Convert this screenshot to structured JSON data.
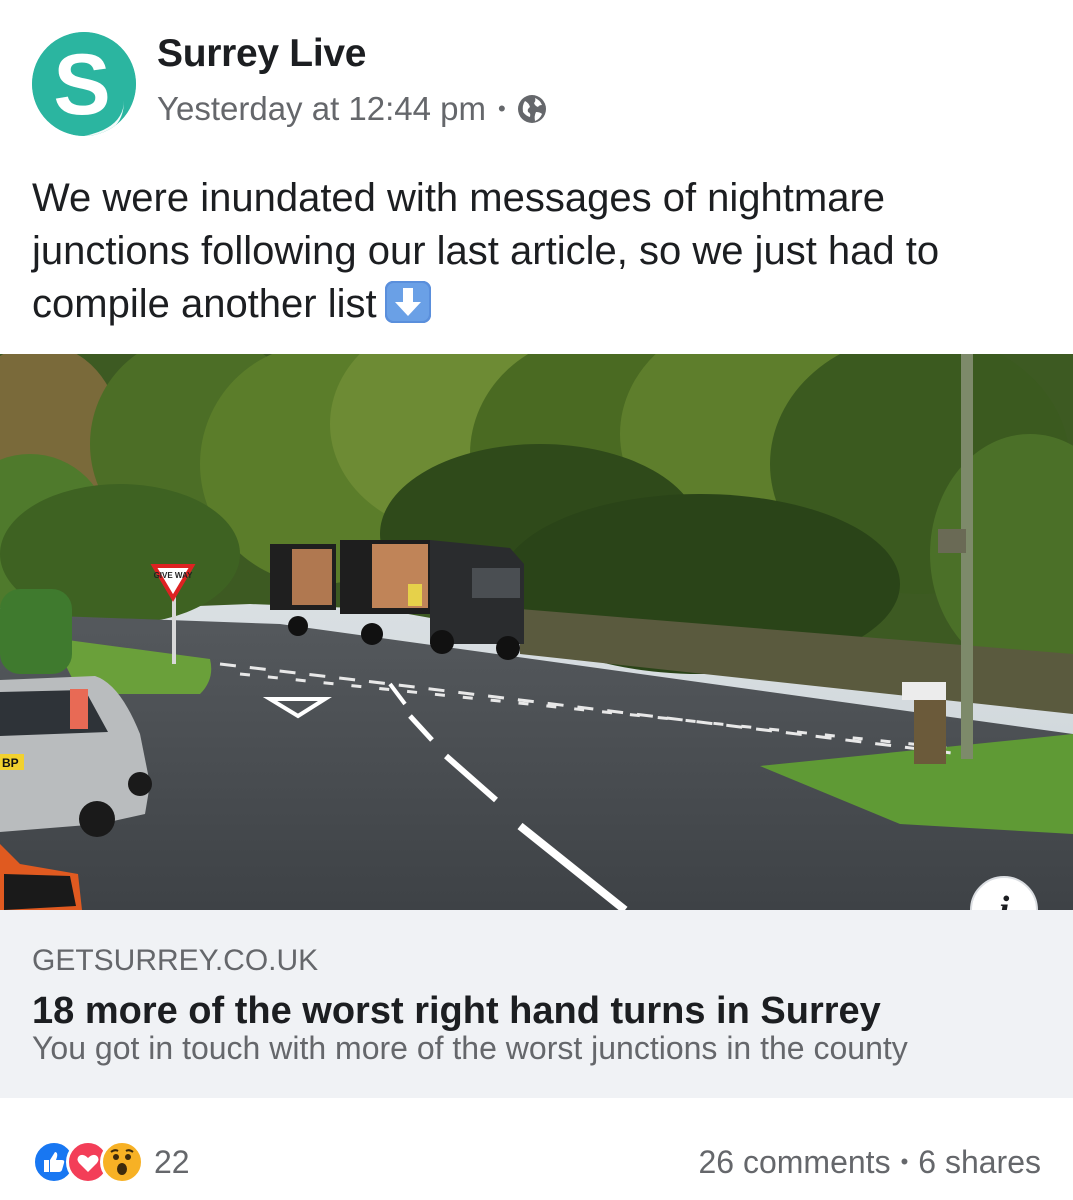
{
  "post": {
    "page_name": "Surrey Live",
    "avatar_letter": "S",
    "timestamp": "Yesterday at 12:44 pm",
    "separator": "•",
    "text": "We were inundated with messages of nightmare junctions following our last article, so we just had to compile another list",
    "emoji_icon": "down-arrow-emoji"
  },
  "photo": {
    "sign_text": "GIVE WAY",
    "plate_text": "BP"
  },
  "link": {
    "domain": "GETSURREY.CO.UK",
    "title": "18 more of the worst right hand turns in Surrey",
    "description": "You got in touch with more of the worst junctions in the county",
    "info_glyph": "i"
  },
  "engagement": {
    "reaction_icons": [
      "like-icon",
      "love-icon",
      "wow-icon"
    ],
    "reaction_count": "22",
    "comments": "26 comments",
    "separator": "•",
    "shares": "6 shares"
  },
  "colors": {
    "brand_teal": "#2bb5a0",
    "like_blue": "#1877f2",
    "love_red": "#f33e58",
    "wow_yellow": "#f7b125",
    "link_card_bg": "#f0f2f5"
  }
}
